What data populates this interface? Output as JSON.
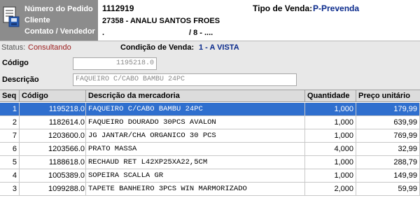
{
  "header": {
    "labels": [
      "Número do Pedido",
      "Cliente",
      "Contato / Vendedor"
    ],
    "order_number": "1112919",
    "client": "27358 - ANALU SANTOS FROES",
    "contact_left": ".",
    "contact_right": "/ 8 - ....",
    "sale_type_label": "Tipo de Venda:",
    "sale_type_value": "P-Prevenda"
  },
  "status": {
    "label": "Status:",
    "value": "Consultando",
    "condition_label": "Condição de Venda:",
    "condition_value": "1  -  A VISTA"
  },
  "form": {
    "code_label": "Código",
    "code_value": "1195218.0",
    "desc_label": "Descrição",
    "desc_value": "FAQUEIRO C/CABO BAMBU 24PC"
  },
  "grid": {
    "columns": [
      "Seq",
      "Código",
      "Descrição da mercadoria",
      "Quantidade",
      "Preço unitário"
    ],
    "rows": [
      {
        "seq": "1",
        "code": "1195218.0",
        "desc": "FAQUEIRO C/CABO BAMBU 24PC",
        "qty": "1,000",
        "price": "179,99"
      },
      {
        "seq": "2",
        "code": "1182614.0",
        "desc": "FAQUEIRO DOURADO 30PCS AVALON",
        "qty": "1,000",
        "price": "639,99"
      },
      {
        "seq": "7",
        "code": "1203600.0",
        "desc": "JG JANTAR/CHA ORGANICO 30 PCS",
        "qty": "1,000",
        "price": "769,99"
      },
      {
        "seq": "6",
        "code": "1203566.0",
        "desc": "PRATO MASSA",
        "qty": "4,000",
        "price": "32,99"
      },
      {
        "seq": "5",
        "code": "1188618.0",
        "desc": "RECHAUD RET L42XP25XA22,5CM",
        "qty": "1,000",
        "price": "288,79"
      },
      {
        "seq": "4",
        "code": "1005389.0",
        "desc": "SOPEIRA SCALLA GR",
        "qty": "1,000",
        "price": "149,99"
      },
      {
        "seq": "3",
        "code": "1099288.0",
        "desc": "TAPETE BANHEIRO 3PCS WIN MARMORIZADO",
        "qty": "2,000",
        "price": "59,99"
      }
    ]
  }
}
